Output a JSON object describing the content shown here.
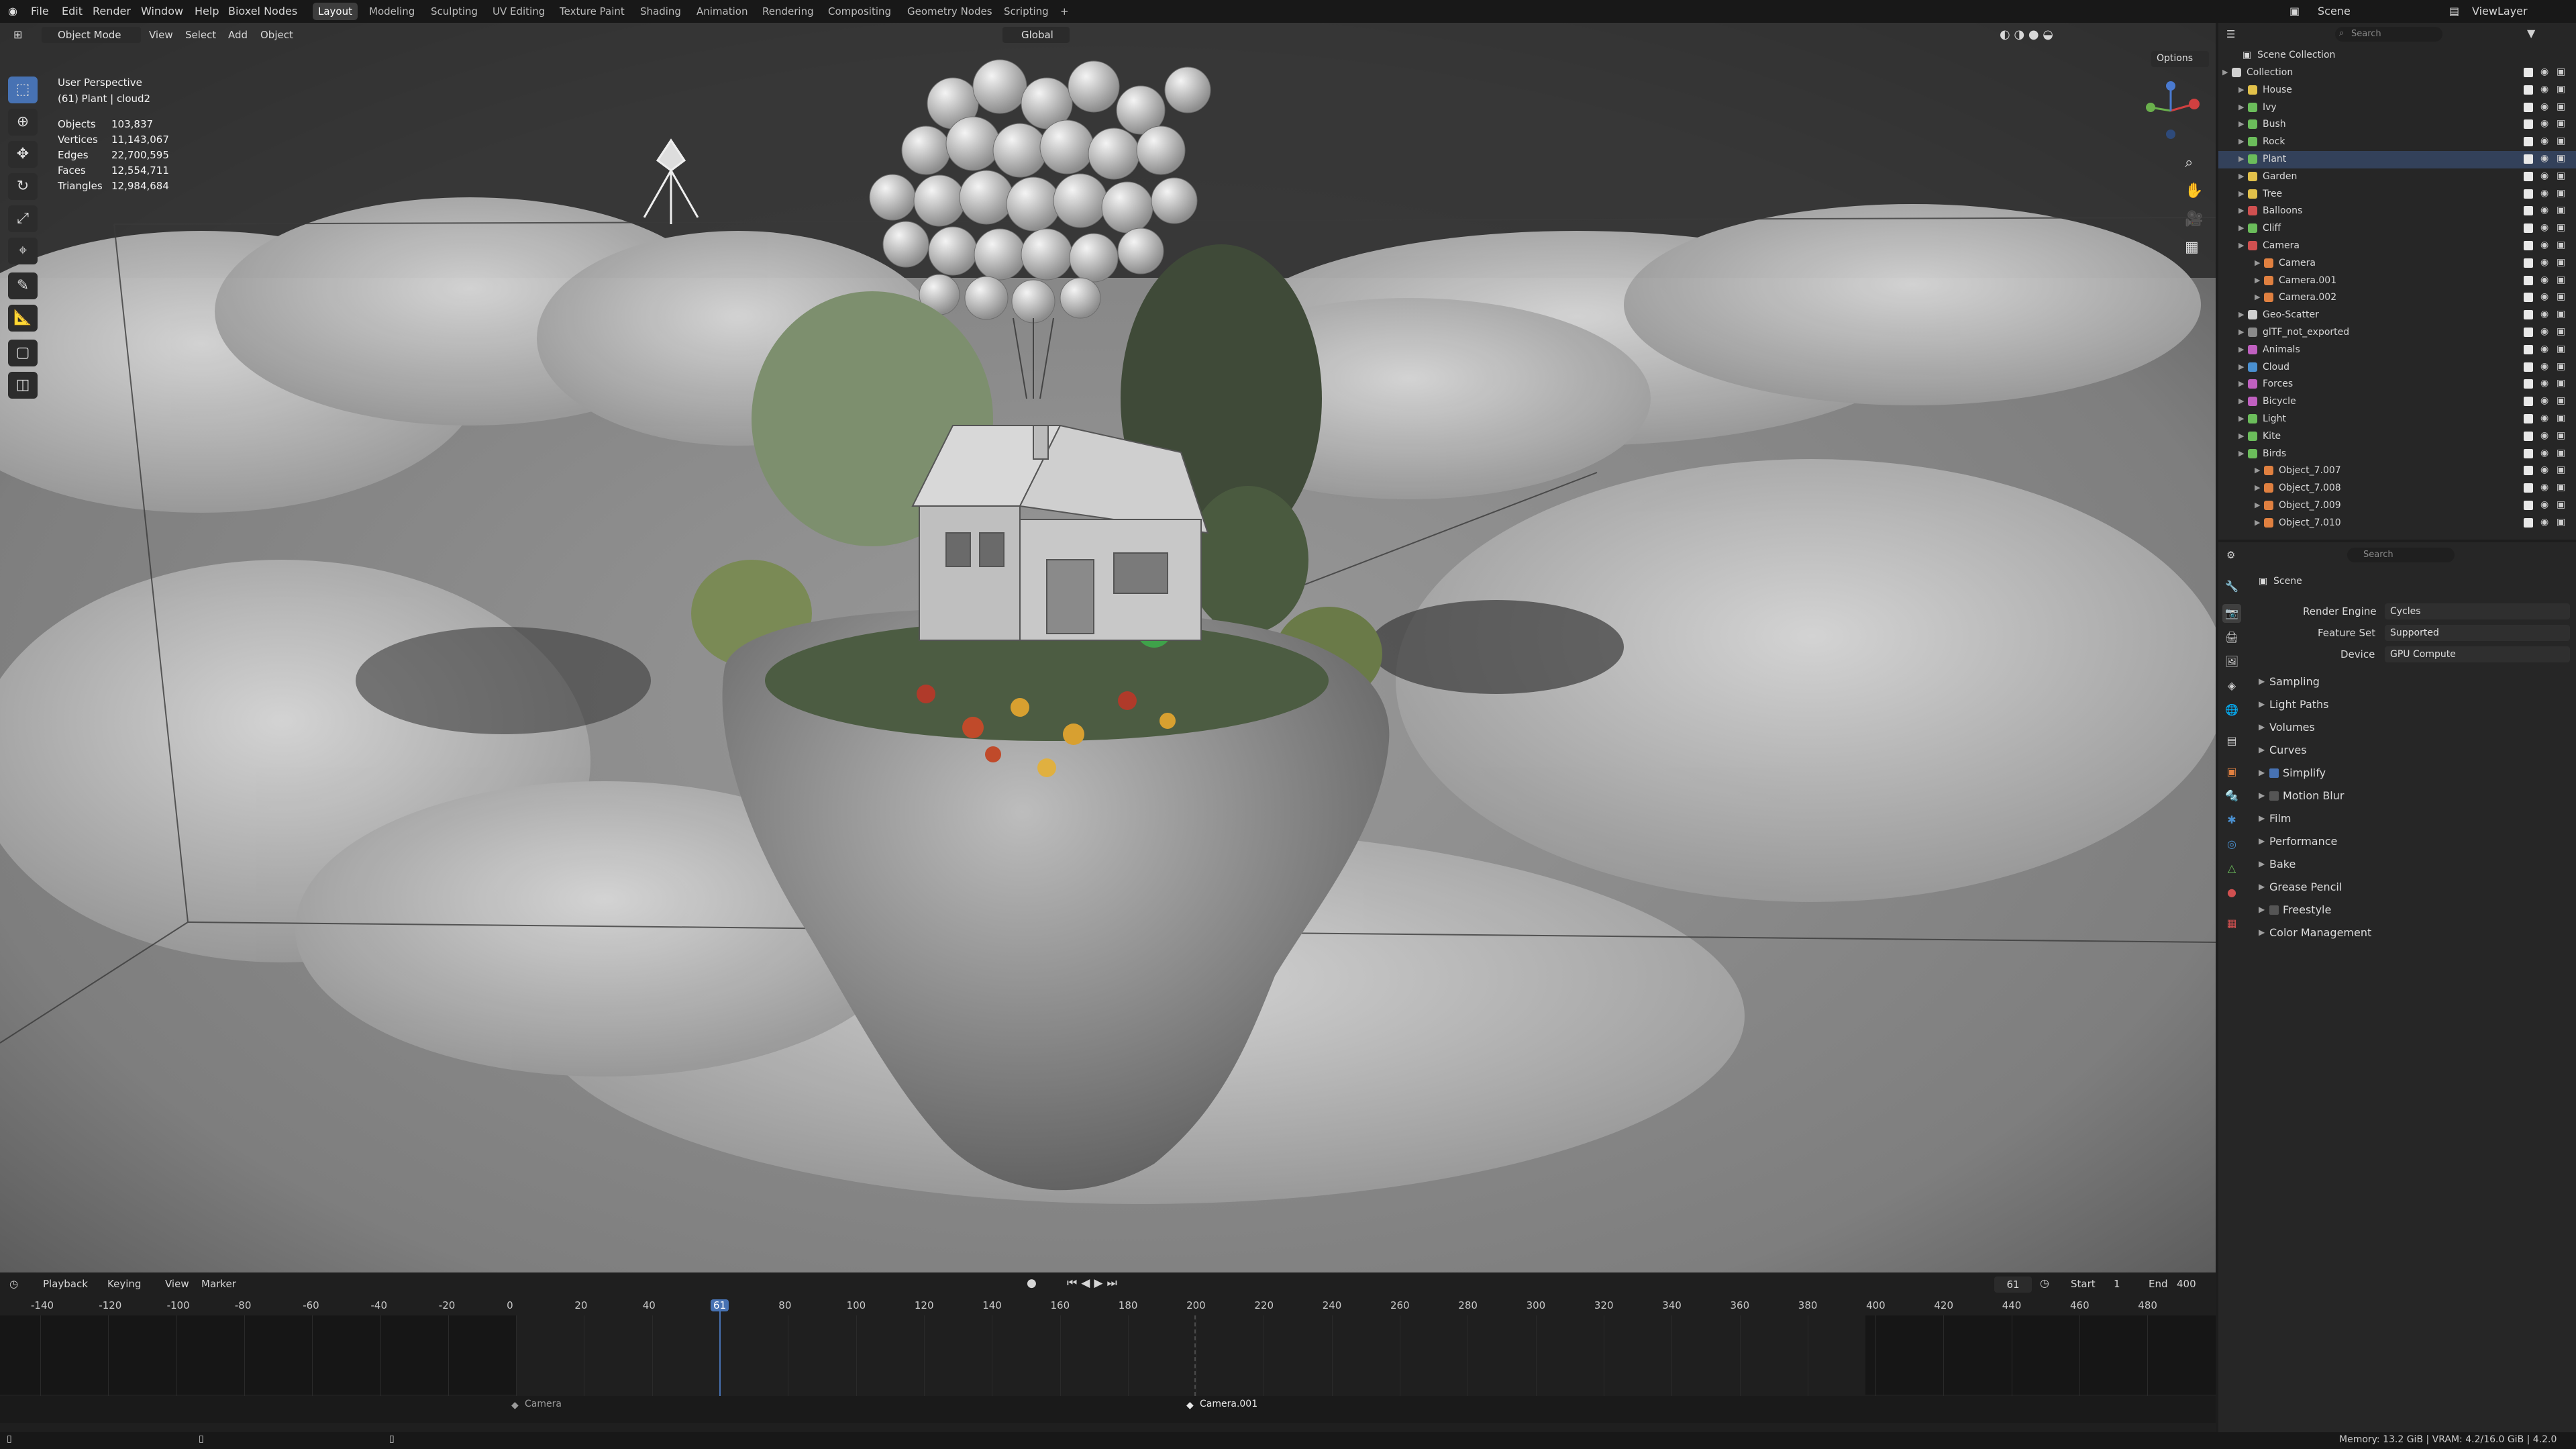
{
  "menubar": {
    "menus": [
      "File",
      "Edit",
      "Render",
      "Window",
      "Help",
      "Bioxel Nodes"
    ],
    "workspaces": [
      "Layout",
      "Modeling",
      "Sculpting",
      "UV Editing",
      "Texture Paint",
      "Shading",
      "Animation",
      "Rendering",
      "Compositing",
      "Geometry Nodes",
      "Scripting"
    ],
    "active_workspace": "Layout",
    "add_tab": "+",
    "scene": "Scene",
    "view_layer": "ViewLayer"
  },
  "viewport_header": {
    "mode": "Object Mode",
    "menus": [
      "View",
      "Select",
      "Add",
      "Object"
    ],
    "transform_orientation": "Global",
    "options": "Options"
  },
  "viewport": {
    "perspective": "User Perspective",
    "active": "(61) Plant | cloud2",
    "stats": [
      {
        "label": "Objects",
        "value": "103,837"
      },
      {
        "label": "Vertices",
        "value": "11,143,067"
      },
      {
        "label": "Edges",
        "value": "22,700,595"
      },
      {
        "label": "Faces",
        "value": "12,554,711"
      },
      {
        "label": "Triangles",
        "value": "12,984,684"
      }
    ]
  },
  "outliner": {
    "search_placeholder": "Search",
    "root": "Scene Collection",
    "items": [
      {
        "label": "Collection",
        "depth": 0,
        "color": "#d0d0d0"
      },
      {
        "label": "House",
        "depth": 1,
        "color": "#e2c14a"
      },
      {
        "label": "Ivy",
        "depth": 1,
        "color": "#6bbd5b"
      },
      {
        "label": "Bush",
        "depth": 1,
        "color": "#6bbd5b"
      },
      {
        "label": "Rock",
        "depth": 1,
        "color": "#6bbd5b"
      },
      {
        "label": "Plant",
        "depth": 1,
        "color": "#6bbd5b"
      },
      {
        "label": "Garden",
        "depth": 1,
        "color": "#e2c14a"
      },
      {
        "label": "Tree",
        "depth": 1,
        "color": "#e2c14a"
      },
      {
        "label": "Balloons",
        "depth": 1,
        "color": "#d05050"
      },
      {
        "label": "Cliff",
        "depth": 1,
        "color": "#6bbd5b"
      },
      {
        "label": "Camera",
        "depth": 1,
        "color": "#d05050"
      },
      {
        "label": "Camera",
        "depth": 2,
        "color": "#e08040"
      },
      {
        "label": "Camera.001",
        "depth": 2,
        "color": "#e08040"
      },
      {
        "label": "Camera.002",
        "depth": 2,
        "color": "#e08040"
      },
      {
        "label": "Geo-Scatter",
        "depth": 1,
        "color": "#d0d0d0"
      },
      {
        "label": "glTF_not_exported",
        "depth": 1,
        "color": "#8a8a8a"
      },
      {
        "label": "Animals",
        "depth": 1,
        "color": "#c060c0"
      },
      {
        "label": "Cloud",
        "depth": 1,
        "color": "#4a90d0"
      },
      {
        "label": "Forces",
        "depth": 1,
        "color": "#c060c0"
      },
      {
        "label": "Bicycle",
        "depth": 1,
        "color": "#c060c0"
      },
      {
        "label": "Light",
        "depth": 1,
        "color": "#6bbd5b"
      },
      {
        "label": "Kite",
        "depth": 1,
        "color": "#6bbd5b"
      },
      {
        "label": "Birds",
        "depth": 1,
        "color": "#6bbd5b"
      },
      {
        "label": "Object_7.007",
        "depth": 2,
        "color": "#e08040"
      },
      {
        "label": "Object_7.008",
        "depth": 2,
        "color": "#e08040"
      },
      {
        "label": "Object_7.009",
        "depth": 2,
        "color": "#e08040"
      },
      {
        "label": "Object_7.010",
        "depth": 2,
        "color": "#e08040"
      }
    ]
  },
  "properties": {
    "search_placeholder": "Search",
    "context": "Scene",
    "render_engine_label": "Render Engine",
    "render_engine": "Cycles",
    "feature_set_label": "Feature Set",
    "feature_set": "Supported",
    "device_label": "Device",
    "device": "GPU Compute",
    "panels": [
      "Sampling",
      "Light Paths",
      "Volumes",
      "Curves",
      "Simplify",
      "Motion Blur",
      "Film",
      "Performance",
      "Bake",
      "Grease Pencil",
      "Freestyle",
      "Color Management"
    ]
  },
  "timeline": {
    "menus": [
      "Playback",
      "Keying",
      "View",
      "Marker"
    ],
    "current_frame": "61",
    "start_label": "Start",
    "start": "1",
    "end_label": "End",
    "end": "400",
    "ticks": [
      "-140",
      "-120",
      "-100",
      "-80",
      "-60",
      "-40",
      "-20",
      "0",
      "20",
      "40",
      "61",
      "80",
      "100",
      "120",
      "140",
      "160",
      "180",
      "200",
      "220",
      "240",
      "260",
      "280",
      "300",
      "320",
      "340",
      "360",
      "380",
      "400",
      "420",
      "440",
      "460",
      "480"
    ],
    "markers": [
      "Camera",
      "Camera.001"
    ]
  },
  "statusbar": {
    "memory": "Memory: 13.2 GiB | VRAM: 4.2/16.0 GiB | 4.2.0"
  }
}
